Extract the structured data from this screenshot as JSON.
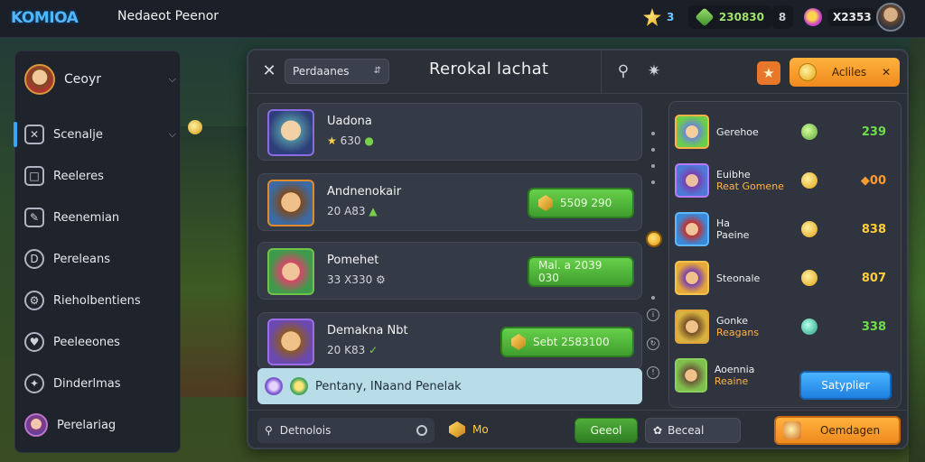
{
  "topbar": {
    "logo": "KOMIOA",
    "title": "Nedaeot Peenor",
    "stars": "3",
    "gems": "230830",
    "slot": "8",
    "orbs": "X2353"
  },
  "sidebar": {
    "profile_label": "Ceoyr",
    "items": [
      {
        "label": "Scenalje",
        "icon": "x-box-icon"
      },
      {
        "label": "Reeleres",
        "icon": "square-icon"
      },
      {
        "label": "Reenemian",
        "icon": "pencil-icon"
      },
      {
        "label": "Pereleans",
        "icon": "d-circle-icon"
      },
      {
        "label": "Rieholbentiens",
        "icon": "wrench-icon"
      },
      {
        "label": "Peeleeones",
        "icon": "heart-icon"
      },
      {
        "label": "Dinderlmas",
        "icon": "compass-icon"
      },
      {
        "label": "Perelariag",
        "icon": "avatar"
      }
    ]
  },
  "panel": {
    "dropdown": "Perdaanes",
    "title": "Rerokal lachat",
    "action_label": "Acliles",
    "cards": [
      {
        "name": "Uadona",
        "sub": "630",
        "sub_prefix": "",
        "btn": ""
      },
      {
        "name": "Andnenokair",
        "sub": "20 A83",
        "btn": "5509 290"
      },
      {
        "name": "Pomehet",
        "sub": "33 X330",
        "btn": "Mal. a 2039 030"
      },
      {
        "name": "Demakna Nbt",
        "sub": "20 K83",
        "btn": "Sebt 2583100"
      }
    ],
    "notice": "Pentany, INaand Penelak",
    "right_rows": [
      {
        "name": "Gerehoe",
        "accent": "",
        "value": "239"
      },
      {
        "name": "Euibhe",
        "accent": "Reat Gomene",
        "value": "00"
      },
      {
        "name": "Ha",
        "accent": "Paeine",
        "value": "838"
      },
      {
        "name": "Steonale",
        "accent": "",
        "value": "807"
      },
      {
        "name": "Gonke",
        "accent": "Reagans",
        "value": "338"
      },
      {
        "name": "Aoennia",
        "accent": "Reaine",
        "value": ""
      }
    ],
    "right_button": "Satyplier",
    "footer": {
      "search": "Detnolois",
      "coins": "Mo",
      "green_button": "Geeol",
      "dark_button": "Beceal",
      "orange_button": "Oemdagen"
    }
  },
  "colors": {
    "accent_blue": "#3ea3ff",
    "gold": "#ffce3a",
    "green": "#6fdc4a",
    "orange": "#f08a1e"
  }
}
